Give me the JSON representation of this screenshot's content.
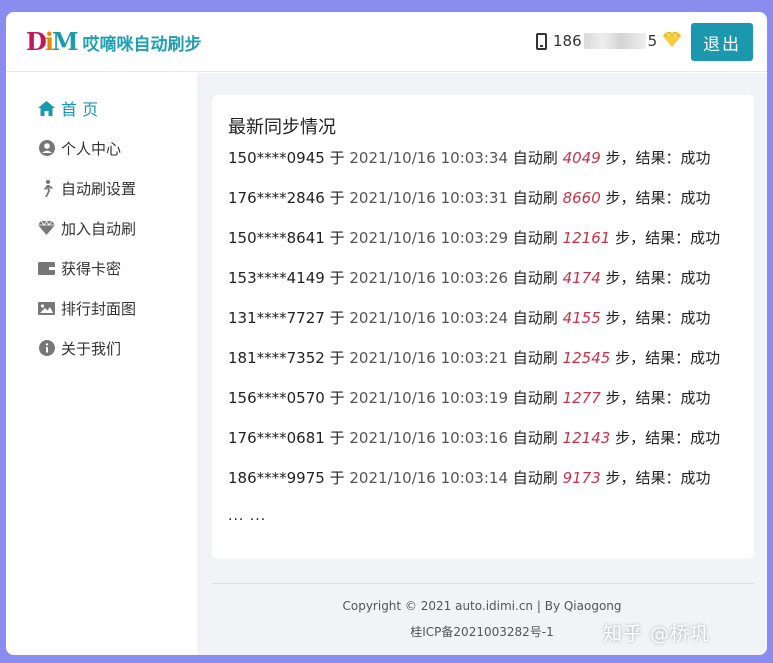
{
  "header": {
    "logo_mark": [
      "D",
      "i",
      "M"
    ],
    "app_title": "哎嘀咪自动刷步",
    "phone_prefix": "186",
    "phone_suffix": "5",
    "logout_label": "退出"
  },
  "sidebar": {
    "items": [
      {
        "label": "首 页",
        "icon": "home-icon",
        "active": true
      },
      {
        "label": "个人中心",
        "icon": "user-circle-icon"
      },
      {
        "label": "自动刷设置",
        "icon": "walking-icon"
      },
      {
        "label": "加入自动刷",
        "icon": "gem-icon"
      },
      {
        "label": "获得卡密",
        "icon": "wallet-icon"
      },
      {
        "label": "排行封面图",
        "icon": "image-icon"
      },
      {
        "label": "关于我们",
        "icon": "info-icon"
      }
    ]
  },
  "main": {
    "card_title": "最新同步情况",
    "word_at": "于",
    "word_auto": "自动刷",
    "word_result": "步，结果：",
    "records": [
      {
        "phone": "150****0945",
        "time": "2021/10/16 10:03:34",
        "steps": "4049",
        "result": "成功"
      },
      {
        "phone": "176****2846",
        "time": "2021/10/16 10:03:31",
        "steps": "8660",
        "result": "成功"
      },
      {
        "phone": "150****8641",
        "time": "2021/10/16 10:03:29",
        "steps": "12161",
        "result": "成功"
      },
      {
        "phone": "153****4149",
        "time": "2021/10/16 10:03:26",
        "steps": "4174",
        "result": "成功"
      },
      {
        "phone": "131****7727",
        "time": "2021/10/16 10:03:24",
        "steps": "4155",
        "result": "成功"
      },
      {
        "phone": "181****7352",
        "time": "2021/10/16 10:03:21",
        "steps": "12545",
        "result": "成功"
      },
      {
        "phone": "156****0570",
        "time": "2021/10/16 10:03:19",
        "steps": "1277",
        "result": "成功"
      },
      {
        "phone": "176****0681",
        "time": "2021/10/16 10:03:16",
        "steps": "12143",
        "result": "成功"
      },
      {
        "phone": "186****9975",
        "time": "2021/10/16 10:03:14",
        "steps": "9173",
        "result": "成功"
      }
    ],
    "more": "... ..."
  },
  "footer": {
    "copyright": "Copyright © 2021 auto.idimi.cn | By Qiaogong",
    "icp": "桂ICP备2021003282号-1"
  },
  "watermark": "知乎 @桥巩",
  "colors": {
    "accent": "#1b98ad",
    "steps": "#c8334a",
    "gem": "#f2b705"
  }
}
